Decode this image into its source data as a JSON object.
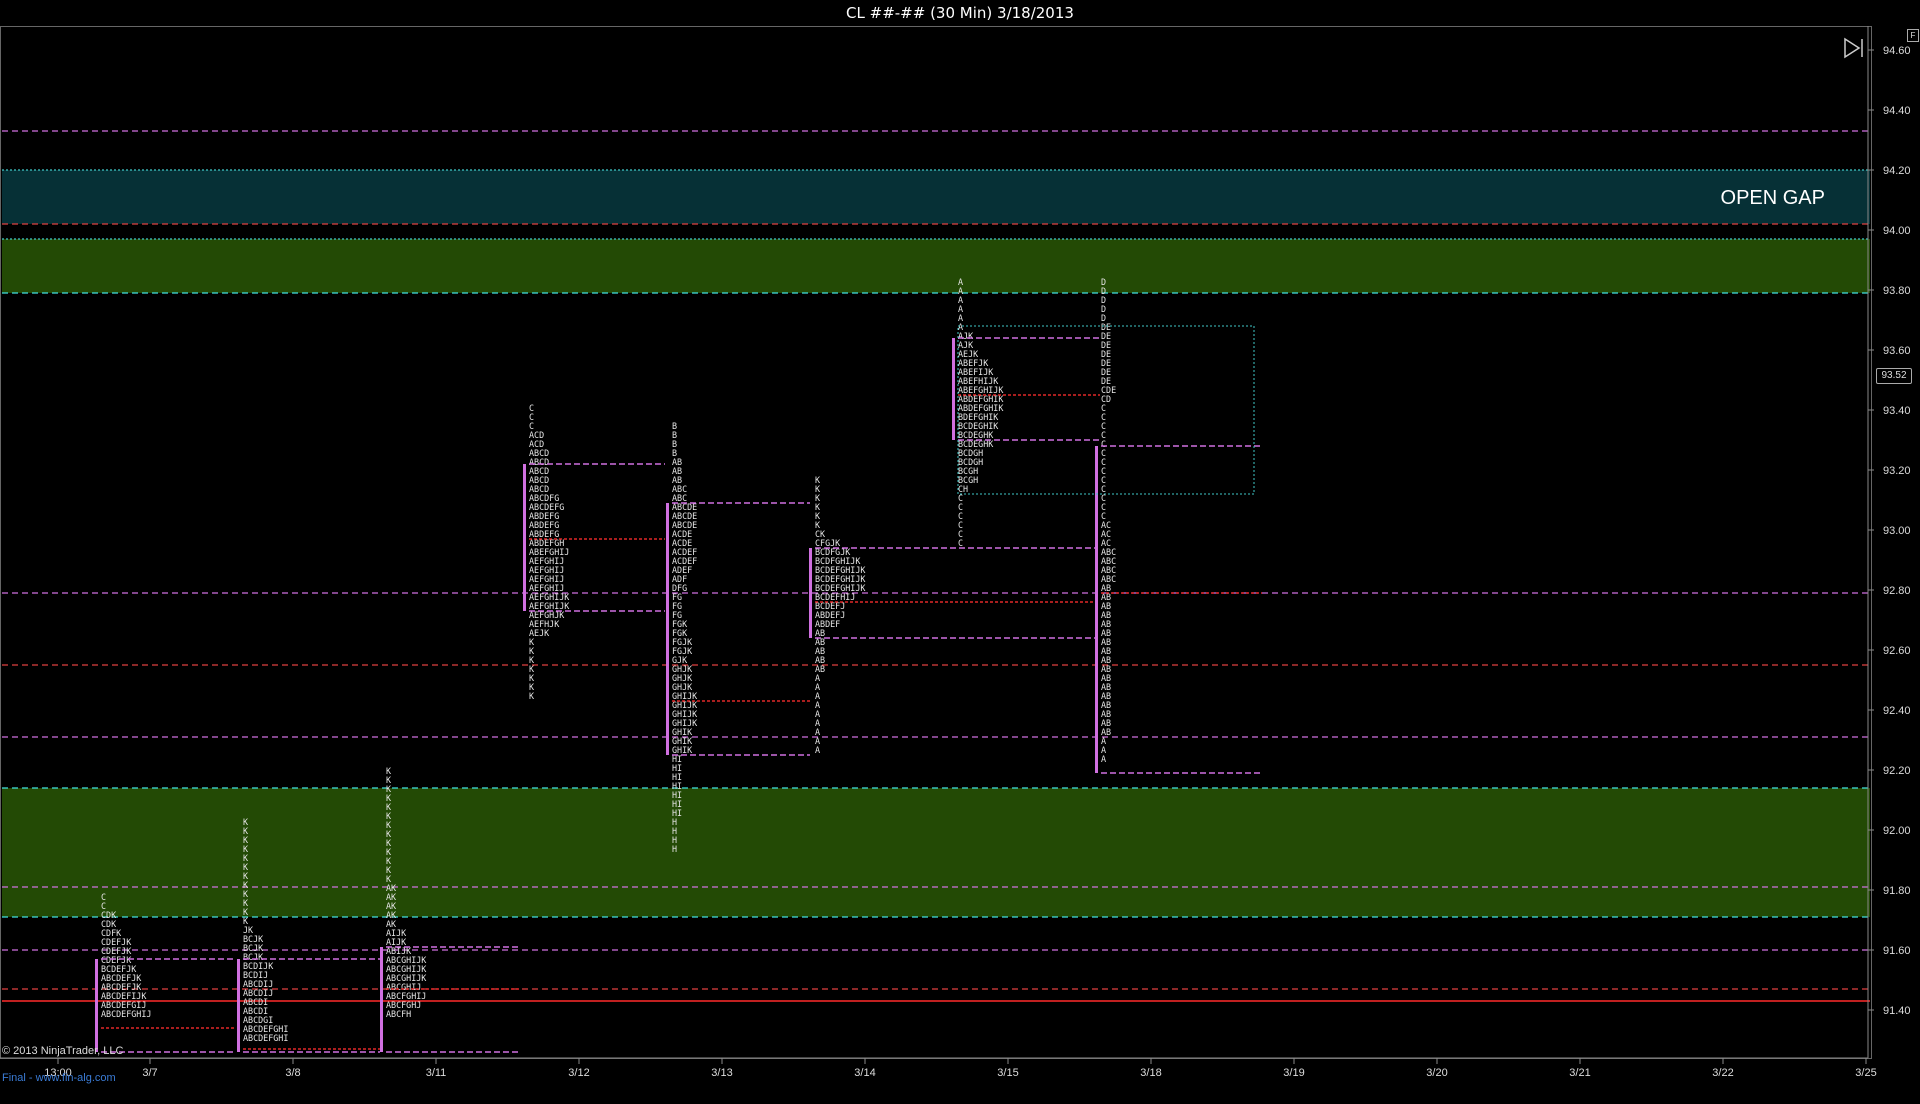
{
  "window": {
    "title": "CL ##-## (30 Min)  3/18/2013",
    "copyright": "© 2013 NinjaTrader, LLC",
    "footer_link": "Final - www.fin-alg.com",
    "current_price_label": "93.52",
    "panel_button": "F",
    "icons": [
      "play-end-icon"
    ]
  },
  "chart_data": {
    "type": "market-profile",
    "title": "CL ##-## (30 Min)  3/18/2013",
    "x_ticks": [
      "13:00",
      "3/7",
      "3/8",
      "3/11",
      "3/12",
      "3/13",
      "3/14",
      "3/15",
      "3/18",
      "3/19",
      "3/20",
      "3/21",
      "3/22",
      "3/25"
    ],
    "y_ticks": [
      94.6,
      94.4,
      94.2,
      94.0,
      93.8,
      93.6,
      93.4,
      93.2,
      93.0,
      92.8,
      92.6,
      92.4,
      92.2,
      92.0,
      91.8,
      91.6,
      91.4
    ],
    "ylim": [
      91.25,
      94.67
    ],
    "tick_size": 0.03,
    "zones": [
      {
        "label": "OPEN GAP",
        "low": 94.02,
        "high": 94.2,
        "color": "#063036"
      },
      {
        "label": "",
        "low": 93.79,
        "high": 93.97,
        "color": "#234a05"
      },
      {
        "label": "",
        "low": 91.71,
        "high": 92.14,
        "color": "#234a05"
      }
    ],
    "levels": [
      {
        "price": 94.33,
        "color": "#d070e0",
        "style": "dashed"
      },
      {
        "price": 94.2,
        "color": "#40c8c8",
        "style": "dotted"
      },
      {
        "price": 94.02,
        "color": "#e04040",
        "style": "dashed"
      },
      {
        "price": 93.97,
        "color": "#40c8c8",
        "style": "dotted"
      },
      {
        "price": 93.79,
        "color": "#40e0e0",
        "style": "dashed"
      },
      {
        "price": 92.79,
        "color": "#d070e0",
        "style": "dashed"
      },
      {
        "price": 92.55,
        "color": "#e04040",
        "style": "dashed"
      },
      {
        "price": 92.31,
        "color": "#d070e0",
        "style": "dashed"
      },
      {
        "price": 92.14,
        "color": "#40e0e0",
        "style": "dashed"
      },
      {
        "price": 91.81,
        "color": "#d070e0",
        "style": "dashed"
      },
      {
        "price": 91.71,
        "color": "#40e0e0",
        "style": "dashed"
      },
      {
        "price": 91.6,
        "color": "#d070e0",
        "style": "dashed"
      },
      {
        "price": 91.47,
        "color": "#e04040",
        "style": "dashed"
      },
      {
        "price": 91.43,
        "color": "#ff2a2a",
        "style": "solid"
      }
    ],
    "profiles": [
      {
        "date": "3/6",
        "top": 91.79,
        "value_area": [
          91.26,
          91.57
        ],
        "vah": 91.57,
        "val": 91.26,
        "poc": 91.34,
        "rows": [
          "C",
          "C",
          "CDK",
          "CDK",
          "CDFK",
          "CDEFJK",
          "CDEFJK",
          "CDEFJK",
          "BCDEFJK",
          "ABCDEFJK",
          "ABCDEFJK",
          "ABCDEFIJK",
          "ABCDEFGIJ",
          "ABCDEFGHIJ"
        ]
      },
      {
        "date": "3/7",
        "top": 92.04,
        "value_area": [
          91.26,
          91.57
        ],
        "vah": 91.57,
        "val": 91.26,
        "poc": 91.27,
        "rows": [
          "K",
          "K",
          "K",
          "K",
          "K",
          "K",
          "K",
          "K",
          "K",
          "K",
          "K",
          "K",
          "JK",
          "BCJK",
          "BCJK",
          "BCJK",
          "BCDIJK",
          "BCDIJ",
          "ABCDIJ",
          "ABCDIJ",
          "ABCDI",
          "ABCDI",
          "ABCDGI",
          "ABCDEFGHI",
          "ABCDEFGHI"
        ]
      },
      {
        "date": "3/8",
        "top": 92.21,
        "value_area": [
          91.26,
          91.61
        ],
        "vah": 91.61,
        "val": 91.26,
        "poc": 91.47,
        "rows": [
          "K",
          "K",
          "K",
          "K",
          "K",
          "K",
          "K",
          "K",
          "K",
          "K",
          "K",
          "K",
          "K",
          "AK",
          "AK",
          "AK",
          "AK",
          "AK",
          "AIJK",
          "AIJK",
          "ABIJK",
          "ABCGHIJK",
          "ABCGHIJK",
          "ABCGHIJK",
          "ABCGHIJ",
          "ABCFGHIJ",
          "ABCFGHJ",
          "ABCFH"
        ]
      },
      {
        "date": "3/11",
        "top": 93.42,
        "value_area": [
          92.73,
          93.22
        ],
        "vah": 93.22,
        "val": 92.73,
        "poc": 92.97,
        "rows": [
          "C",
          "C",
          "C",
          "ACD",
          "ACD",
          "ABCD",
          "ABCD",
          "ABCD",
          "ABCD",
          "ABCD",
          "ABCDFG",
          "ABCDEFG",
          "ABDEFG",
          "ABDEFG",
          "ABDEFG",
          "ABDEFGH",
          "ABEFGHIJ",
          "AEFGHIJ",
          "AEFGHIJ",
          "AEFGHIJ",
          "AEFGHIJ",
          "AEFGHIJK",
          "AEFGHIJK",
          "AEFGHJK",
          "AEFHJK",
          "AEJK",
          "K",
          "K",
          "K",
          "K",
          "K",
          "K",
          "K"
        ]
      },
      {
        "date": "3/12",
        "top": 93.36,
        "value_area": [
          92.25,
          93.09
        ],
        "vah": 93.09,
        "val": 92.25,
        "poc": 92.43,
        "rows": [
          "B",
          "B",
          "B",
          "B",
          "AB",
          "AB",
          "AB",
          "ABC",
          "ABC",
          "ABCDE",
          "ABCDE",
          "ABCDE",
          "ACDE",
          "ACDE",
          "ACDEF",
          "ACDEF",
          "ADEF",
          "ADF",
          "DFG",
          "FG",
          "FG",
          "FG",
          "FGK",
          "FGK",
          "FGJK",
          "FGJK",
          "GJK",
          "GHJK",
          "GHJK",
          "GHJK",
          "GHIJK",
          "GHIJK",
          "GHIJK",
          "GHIJK",
          "GHIK",
          "GHIK",
          "GHIK",
          "HI",
          "HI",
          "HI",
          "HI",
          "HI",
          "HI",
          "HI",
          "H",
          "H",
          "H",
          "H"
        ]
      },
      {
        "date": "3/13",
        "top": 93.18,
        "value_area": [
          92.64,
          92.94
        ],
        "vah": 92.94,
        "val": 92.64,
        "poc": 92.76,
        "rows": [
          "K",
          "K",
          "K",
          "K",
          "K",
          "K",
          "CK",
          "CFGJK",
          "BCDFGJK",
          "BCDFGHIJK",
          "BCDEFGHIJK",
          "BCDEFGHIJK",
          "BCDEFGHIJK",
          "BCDEFHIJ",
          "BCDEFJ",
          "ABDEFJ",
          "ABDEF",
          "AB",
          "AB",
          "AB",
          "AB",
          "AB",
          "A",
          "A",
          "A",
          "A",
          "A",
          "A",
          "A",
          "A",
          "A"
        ]
      },
      {
        "date": "3/14",
        "top": 93.84,
        "value_area": [
          93.3,
          93.64
        ],
        "vah": 93.64,
        "val": 93.3,
        "poc": 93.45,
        "rows": [
          "A",
          "A",
          "A",
          "A",
          "A",
          "A",
          "AJK",
          "AJK",
          "AEJK",
          "ABEFJK",
          "ABEFIJK",
          "ABEFHIJK",
          "ABEFGHIJK",
          "ABDEFGHIK",
          "ABDEFGHIK",
          "BDEFGHIK",
          "BCDEGHIK",
          "BCDEGHK",
          "BCDEGHK",
          "BCDGH",
          "BCDGH",
          "BCGH",
          "BCGH",
          "CH",
          "C",
          "C",
          "C",
          "C",
          "C",
          "C"
        ]
      },
      {
        "date": "3/15",
        "top": 93.84,
        "value_area": [
          92.19,
          93.28
        ],
        "vah": 93.28,
        "val": 92.19,
        "poc": 92.79,
        "rows": [
          "D",
          "D",
          "D",
          "D",
          "D",
          "DE",
          "DE",
          "DE",
          "DE",
          "DE",
          "DE",
          "DE",
          "CDE",
          "CD",
          "C",
          "C",
          "C",
          "C",
          "C",
          "C",
          "C",
          "C",
          "C",
          "C",
          "C",
          "C",
          "C",
          "AC",
          "AC",
          "AC",
          "ABC",
          "ABC",
          "ABC",
          "ABC",
          "AB",
          "AB",
          "AB",
          "AB",
          "AB",
          "AB",
          "AB",
          "AB",
          "AB",
          "AB",
          "AB",
          "AB",
          "AB",
          "AB",
          "AB",
          "AB",
          "AB",
          "A",
          "A",
          "A"
        ]
      }
    ],
    "ib_box": {
      "date": "3/14",
      "low": 93.12,
      "high": 93.68
    }
  }
}
